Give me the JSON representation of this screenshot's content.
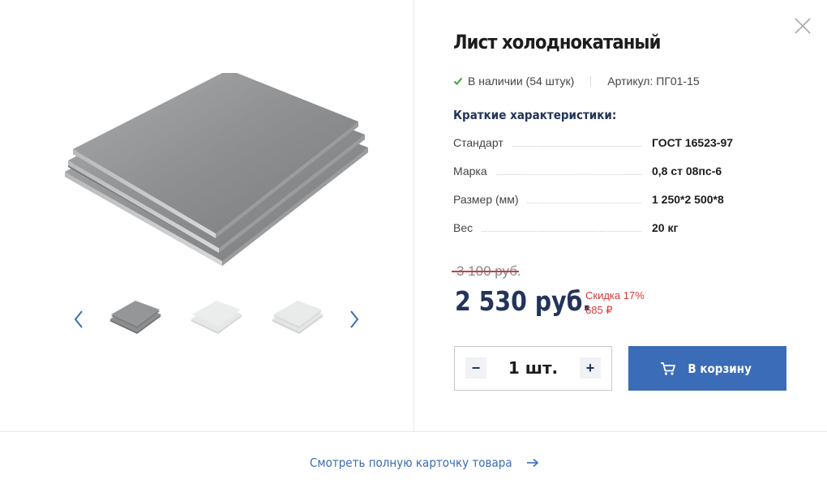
{
  "product": {
    "title": "Лист холоднокатаный",
    "availability": "В наличии (54 штук)",
    "sku": "Артикул: ПГ01-15"
  },
  "specs": {
    "title": "Краткие характеристики:",
    "rows": [
      {
        "label": "Стандарт",
        "value": "ГОСТ 16523-97"
      },
      {
        "label": "Марка",
        "value": "0,8 ст 08пс-6"
      },
      {
        "label": "Размер (мм)",
        "value": "1 250*2 500*8"
      },
      {
        "label": "Вес",
        "value": "20 кг"
      }
    ]
  },
  "pricing": {
    "old_price": "3 100 руб.",
    "price": "2 530 руб.",
    "discount_percent": "Скидка 17%",
    "discount_amount": "685 ₽"
  },
  "cart": {
    "quantity": "1 шт.",
    "minus": "−",
    "plus": "+",
    "add_label": "В корзину"
  },
  "footer": {
    "link_label": "Смотреть полную карточку товара"
  },
  "gallery": {
    "thumbnail_count": 3,
    "selected_index": 0
  },
  "colors": {
    "accent": "#3a6cb8",
    "heading": "#23345b",
    "discount": "#d63a3a",
    "in_stock": "#3aa335"
  },
  "icons": {
    "close": "close-icon",
    "check": "check-icon",
    "prev": "chevron-left-icon",
    "next": "chevron-right-icon",
    "cart": "cart-icon",
    "arrow": "arrow-right-icon"
  }
}
